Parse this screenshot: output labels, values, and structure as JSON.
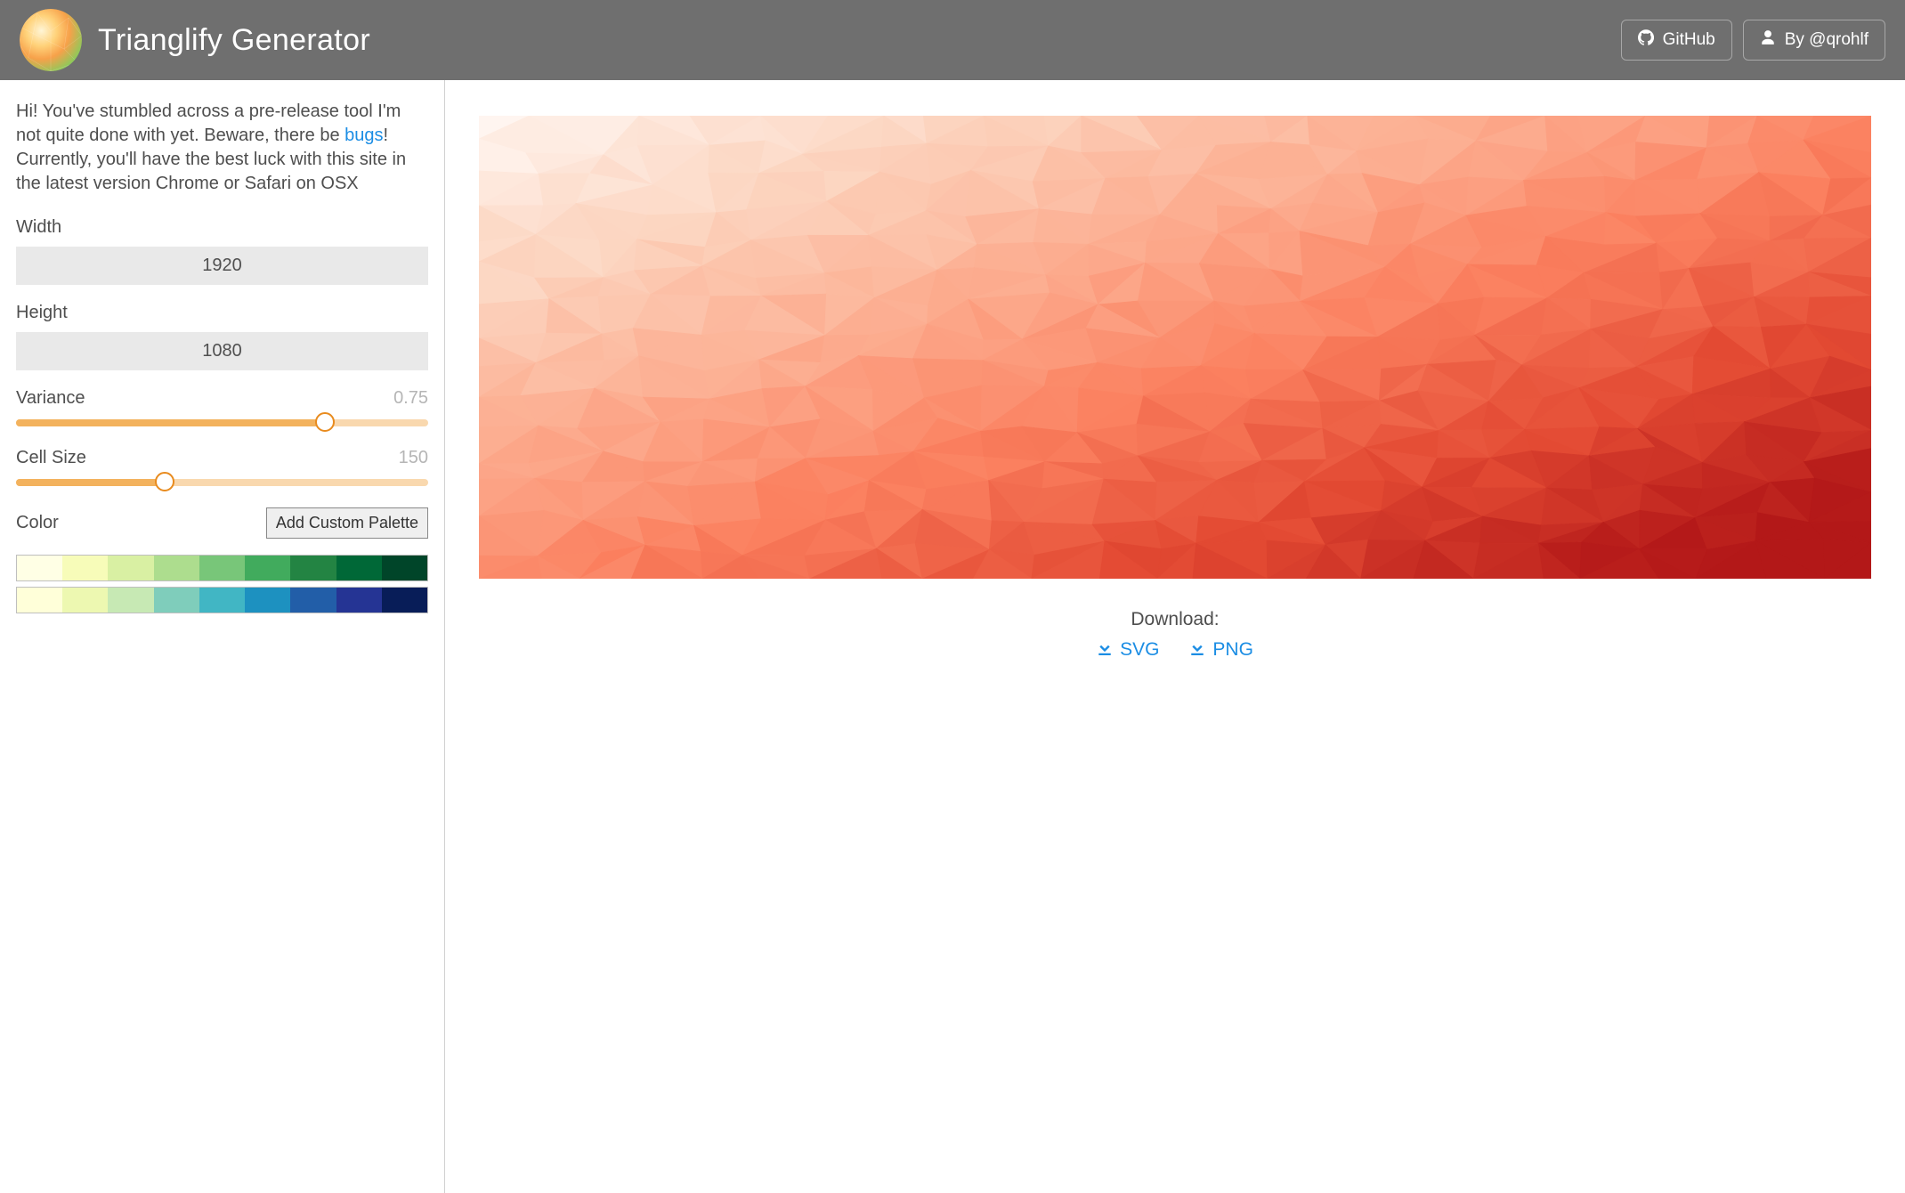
{
  "header": {
    "title": "Trianglify Generator",
    "github_label": "GitHub",
    "author_label": "By @qrohlf"
  },
  "intro": {
    "text_a": "Hi! You've stumbled across a pre-release tool I'm not quite done with yet. Beware, there be ",
    "bugs_link": "bugs",
    "text_b": "! Currently, you'll have the best luck with this site in the latest version Chrome or Safari on OSX"
  },
  "controls": {
    "width_label": "Width",
    "width_value": "1920",
    "height_label": "Height",
    "height_value": "1080",
    "variance_label": "Variance",
    "variance_value": "0.75",
    "variance_percent": 75,
    "cellsize_label": "Cell Size",
    "cellsize_value": "150",
    "cellsize_percent": 36,
    "color_label": "Color",
    "add_palette_label": "Add Custom Palette"
  },
  "palettes": [
    [
      "#ffffe5",
      "#f7fcb9",
      "#d9f0a3",
      "#addd8e",
      "#78c679",
      "#41ab5d",
      "#238443",
      "#006837",
      "#004529"
    ],
    [
      "#ffffd9",
      "#edf8b1",
      "#c7e9b4",
      "#7fcdbb",
      "#41b6c4",
      "#1d91c0",
      "#225ea8",
      "#253494",
      "#081d58"
    ]
  ],
  "download": {
    "label": "Download:",
    "svg_label": "SVG",
    "png_label": "PNG"
  }
}
